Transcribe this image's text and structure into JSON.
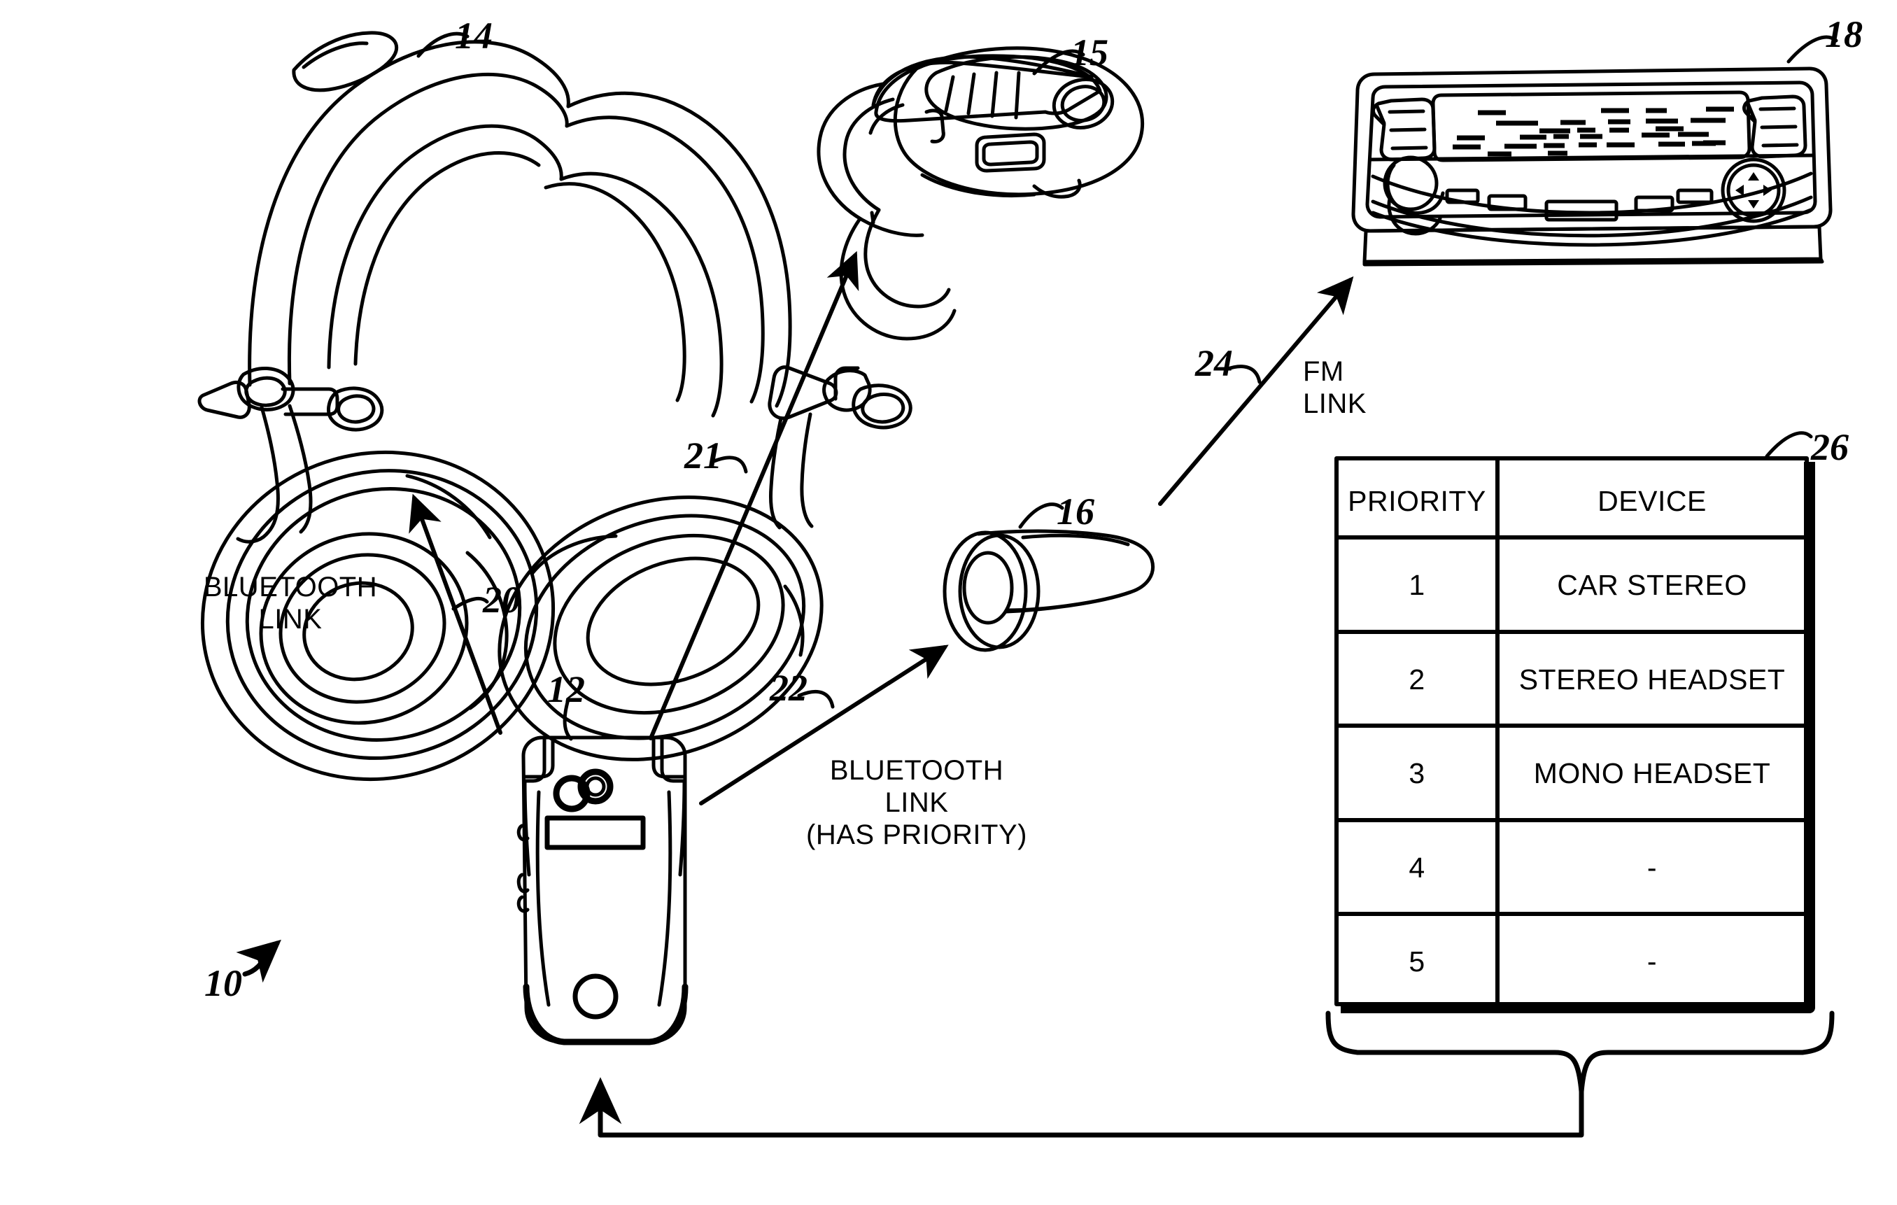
{
  "figure": {
    "figure_ref": "10",
    "reference_numerals": {
      "system": "10",
      "mobile_phone": "12",
      "stereo_headphones": "14",
      "bluetooth_earpiece": "15",
      "mono_headset": "16",
      "car_stereo": "18",
      "link_to_headphones": "20",
      "link_to_earpiece": "21",
      "link_to_mono_headset": "22",
      "link_to_car_stereo": "24",
      "priority_table": "26"
    }
  },
  "links": {
    "headphones_link": "BLUETOOTH\nLINK",
    "mono_headset_link": "BLUETOOTH\nLINK\n(HAS PRIORITY)",
    "car_stereo_link": "FM\nLINK"
  },
  "priority_table": {
    "label": "26",
    "columns": [
      "PRIORITY",
      "DEVICE"
    ],
    "rows": [
      {
        "priority": "1",
        "device": "CAR STEREO"
      },
      {
        "priority": "2",
        "device": "STEREO HEADSET"
      },
      {
        "priority": "3",
        "device": "MONO HEADSET"
      },
      {
        "priority": "4",
        "device": "-"
      },
      {
        "priority": "5",
        "device": "-"
      }
    ]
  },
  "devices": {
    "stereo_headphones_ref": "14",
    "bluetooth_earpiece_ref": "15",
    "mono_headset_ref": "16",
    "car_stereo_ref": "18",
    "mobile_phone_ref": "12"
  },
  "colors": {
    "ink": "#000000",
    "paper": "#ffffff"
  },
  "chart_data": {
    "type": "table",
    "title": "Device priority table",
    "columns": [
      "PRIORITY",
      "DEVICE"
    ],
    "rows": [
      [
        "1",
        "CAR STEREO"
      ],
      [
        "2",
        "STEREO HEADSET"
      ],
      [
        "3",
        "MONO HEADSET"
      ],
      [
        "4",
        "-"
      ],
      [
        "5",
        "-"
      ]
    ]
  }
}
